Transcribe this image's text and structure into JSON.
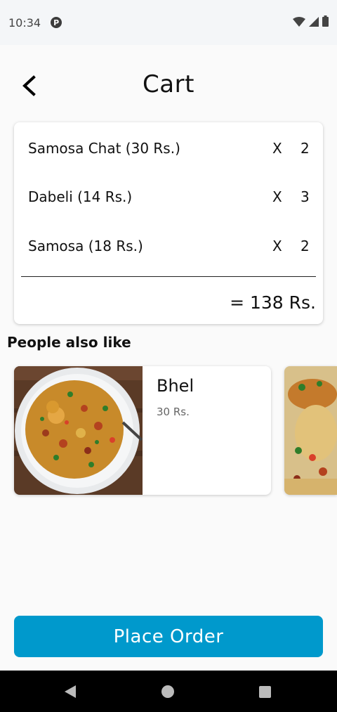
{
  "status_bar": {
    "time": "10:34",
    "app_icon": "p-notification-icon",
    "icons": [
      "wifi-icon",
      "signal-icon",
      "battery-icon"
    ]
  },
  "header": {
    "back_icon": "back-arrow-icon",
    "title": "Cart"
  },
  "cart": {
    "items": [
      {
        "name": "Samosa Chat (30 Rs.)",
        "x": "X",
        "qty": "2"
      },
      {
        "name": "Dabeli (14 Rs.)",
        "x": "X",
        "qty": "3"
      },
      {
        "name": "Samosa (18 Rs.)",
        "x": "X",
        "qty": "2"
      }
    ],
    "total": "= 138 Rs."
  },
  "suggestions": {
    "title": "People also like",
    "items": [
      {
        "name": "Bhel",
        "price": "30 Rs."
      }
    ]
  },
  "place_order": {
    "label": "Place Order"
  },
  "nav_bar": {
    "icons": [
      "back-triangle-icon",
      "home-circle-icon",
      "recents-square-icon"
    ]
  },
  "colors": {
    "accent": "#0099cc",
    "background": "#fafafa",
    "status_bar": "#f4f6f8",
    "nav_bar": "#000000"
  }
}
